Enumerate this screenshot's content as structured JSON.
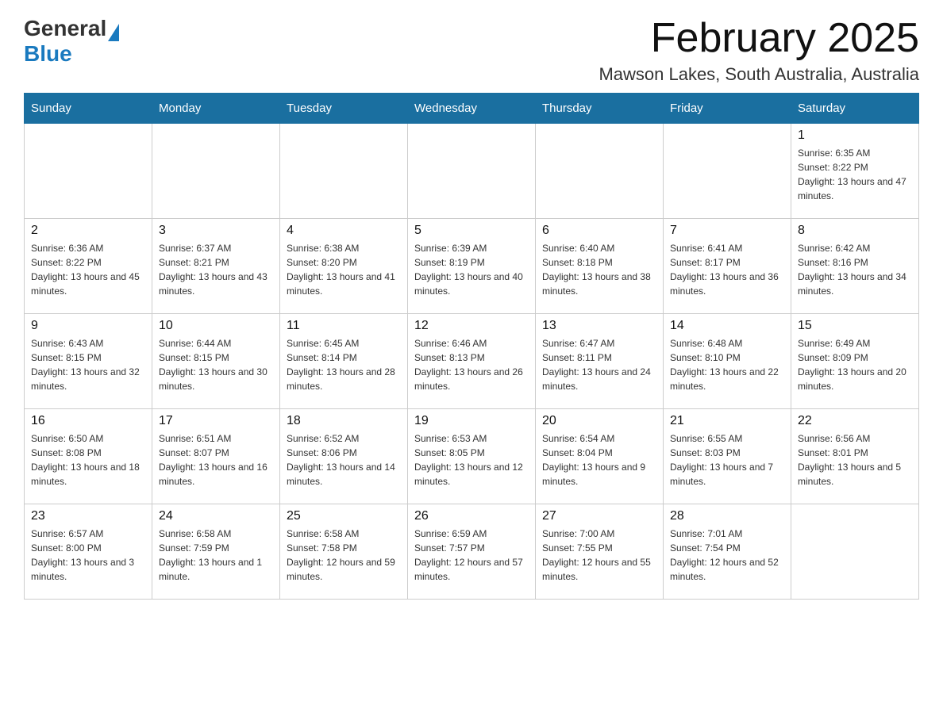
{
  "header": {
    "logo_general": "General",
    "logo_blue": "Blue",
    "title": "February 2025",
    "subtitle": "Mawson Lakes, South Australia, Australia"
  },
  "weekdays": [
    "Sunday",
    "Monday",
    "Tuesday",
    "Wednesday",
    "Thursday",
    "Friday",
    "Saturday"
  ],
  "weeks": [
    [
      {
        "day": "",
        "info": ""
      },
      {
        "day": "",
        "info": ""
      },
      {
        "day": "",
        "info": ""
      },
      {
        "day": "",
        "info": ""
      },
      {
        "day": "",
        "info": ""
      },
      {
        "day": "",
        "info": ""
      },
      {
        "day": "1",
        "info": "Sunrise: 6:35 AM\nSunset: 8:22 PM\nDaylight: 13 hours and 47 minutes."
      }
    ],
    [
      {
        "day": "2",
        "info": "Sunrise: 6:36 AM\nSunset: 8:22 PM\nDaylight: 13 hours and 45 minutes."
      },
      {
        "day": "3",
        "info": "Sunrise: 6:37 AM\nSunset: 8:21 PM\nDaylight: 13 hours and 43 minutes."
      },
      {
        "day": "4",
        "info": "Sunrise: 6:38 AM\nSunset: 8:20 PM\nDaylight: 13 hours and 41 minutes."
      },
      {
        "day": "5",
        "info": "Sunrise: 6:39 AM\nSunset: 8:19 PM\nDaylight: 13 hours and 40 minutes."
      },
      {
        "day": "6",
        "info": "Sunrise: 6:40 AM\nSunset: 8:18 PM\nDaylight: 13 hours and 38 minutes."
      },
      {
        "day": "7",
        "info": "Sunrise: 6:41 AM\nSunset: 8:17 PM\nDaylight: 13 hours and 36 minutes."
      },
      {
        "day": "8",
        "info": "Sunrise: 6:42 AM\nSunset: 8:16 PM\nDaylight: 13 hours and 34 minutes."
      }
    ],
    [
      {
        "day": "9",
        "info": "Sunrise: 6:43 AM\nSunset: 8:15 PM\nDaylight: 13 hours and 32 minutes."
      },
      {
        "day": "10",
        "info": "Sunrise: 6:44 AM\nSunset: 8:15 PM\nDaylight: 13 hours and 30 minutes."
      },
      {
        "day": "11",
        "info": "Sunrise: 6:45 AM\nSunset: 8:14 PM\nDaylight: 13 hours and 28 minutes."
      },
      {
        "day": "12",
        "info": "Sunrise: 6:46 AM\nSunset: 8:13 PM\nDaylight: 13 hours and 26 minutes."
      },
      {
        "day": "13",
        "info": "Sunrise: 6:47 AM\nSunset: 8:11 PM\nDaylight: 13 hours and 24 minutes."
      },
      {
        "day": "14",
        "info": "Sunrise: 6:48 AM\nSunset: 8:10 PM\nDaylight: 13 hours and 22 minutes."
      },
      {
        "day": "15",
        "info": "Sunrise: 6:49 AM\nSunset: 8:09 PM\nDaylight: 13 hours and 20 minutes."
      }
    ],
    [
      {
        "day": "16",
        "info": "Sunrise: 6:50 AM\nSunset: 8:08 PM\nDaylight: 13 hours and 18 minutes."
      },
      {
        "day": "17",
        "info": "Sunrise: 6:51 AM\nSunset: 8:07 PM\nDaylight: 13 hours and 16 minutes."
      },
      {
        "day": "18",
        "info": "Sunrise: 6:52 AM\nSunset: 8:06 PM\nDaylight: 13 hours and 14 minutes."
      },
      {
        "day": "19",
        "info": "Sunrise: 6:53 AM\nSunset: 8:05 PM\nDaylight: 13 hours and 12 minutes."
      },
      {
        "day": "20",
        "info": "Sunrise: 6:54 AM\nSunset: 8:04 PM\nDaylight: 13 hours and 9 minutes."
      },
      {
        "day": "21",
        "info": "Sunrise: 6:55 AM\nSunset: 8:03 PM\nDaylight: 13 hours and 7 minutes."
      },
      {
        "day": "22",
        "info": "Sunrise: 6:56 AM\nSunset: 8:01 PM\nDaylight: 13 hours and 5 minutes."
      }
    ],
    [
      {
        "day": "23",
        "info": "Sunrise: 6:57 AM\nSunset: 8:00 PM\nDaylight: 13 hours and 3 minutes."
      },
      {
        "day": "24",
        "info": "Sunrise: 6:58 AM\nSunset: 7:59 PM\nDaylight: 13 hours and 1 minute."
      },
      {
        "day": "25",
        "info": "Sunrise: 6:58 AM\nSunset: 7:58 PM\nDaylight: 12 hours and 59 minutes."
      },
      {
        "day": "26",
        "info": "Sunrise: 6:59 AM\nSunset: 7:57 PM\nDaylight: 12 hours and 57 minutes."
      },
      {
        "day": "27",
        "info": "Sunrise: 7:00 AM\nSunset: 7:55 PM\nDaylight: 12 hours and 55 minutes."
      },
      {
        "day": "28",
        "info": "Sunrise: 7:01 AM\nSunset: 7:54 PM\nDaylight: 12 hours and 52 minutes."
      },
      {
        "day": "",
        "info": ""
      }
    ]
  ]
}
